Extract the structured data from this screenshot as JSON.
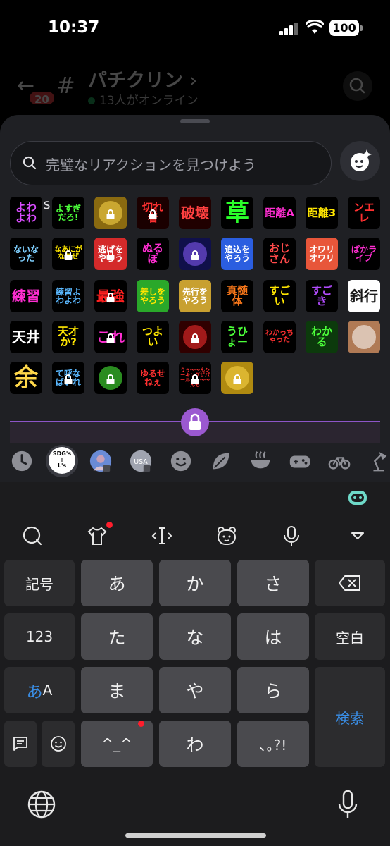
{
  "status_bar": {
    "time": "10:37",
    "battery": "100"
  },
  "channel_header": {
    "unread_count": "20",
    "title": "パチクリン",
    "title_chevron": "›",
    "online": "13人がオンライン"
  },
  "picker": {
    "search_placeholder": "完璧なリアクションを見つけよう",
    "pack_title": "SDG's＋L's",
    "emojis": [
      {
        "text": "よわよわ",
        "fg": "#d94cff",
        "bg": "#000000"
      },
      {
        "text": "よすぎだろ!",
        "fg": "#4cff3a",
        "bg": "#000000"
      },
      {
        "text": "",
        "fg": "#ffd84a",
        "bg": "#8a6a10"
      },
      {
        "text": "切れ者",
        "fg": "#ff3030",
        "bg": "#1a0000"
      },
      {
        "text": "破壊",
        "fg": "#ff4040",
        "bg": "#200000"
      },
      {
        "text": "草",
        "fg": "#2aff2a",
        "bg": "#000000"
      },
      {
        "text": "距離A",
        "fg": "#ff2ed2",
        "bg": "#000000"
      },
      {
        "text": "距離3",
        "fg": "#ffe600",
        "bg": "#000000"
      },
      {
        "text": "ンエレ",
        "fg": "#ff3030",
        "bg": "#000000"
      },
      {
        "text": "ないなった",
        "fg": "#7fd0ff",
        "bg": "#000000"
      },
      {
        "text": "なあにがなあぜ",
        "fg": "#ffe600",
        "bg": "#000000"
      },
      {
        "text": "逃げをやろう",
        "fg": "#ffffff",
        "bg": "#d42a2a"
      },
      {
        "text": "ぬるぽ",
        "fg": "#ff2ed2",
        "bg": "#000000"
      },
      {
        "text": "",
        "fg": "#8a5cff",
        "bg": "#10104a"
      },
      {
        "text": "追込をやろう",
        "fg": "#ffffff",
        "bg": "#2b5ee0"
      },
      {
        "text": "おじさん",
        "fg": "#ff4a4a",
        "bg": "#000000"
      },
      {
        "text": "オワリオワリ",
        "fg": "#ffffff",
        "bg": "#e8563a"
      },
      {
        "text": "ぱかライブ",
        "fg": "#ff2ed2",
        "bg": "#000000"
      },
      {
        "text": "練習",
        "fg": "#ff2ed2",
        "bg": "#000000"
      },
      {
        "text": "練習よわよわ",
        "fg": "#5ab8ff",
        "bg": "#000000"
      },
      {
        "text": "最強",
        "fg": "#ff2020",
        "bg": "#000000"
      },
      {
        "text": "差しをやろう",
        "fg": "#ffe600",
        "bg": "#2aa82a"
      },
      {
        "text": "先行をやろう",
        "fg": "#ffffff",
        "bg": "#c8a030"
      },
      {
        "text": "真髄体",
        "fg": "#ff7a1a",
        "bg": "#000000"
      },
      {
        "text": "すごい",
        "fg": "#ffe600",
        "bg": "#000000"
      },
      {
        "text": "すごき",
        "fg": "#b34cff",
        "bg": "#000000"
      },
      {
        "text": "斜行",
        "fg": "#1a1a1a",
        "bg": "#ffffff"
      },
      {
        "text": "天井",
        "fg": "#ffffff",
        "bg": "#000000"
      },
      {
        "text": "天才か?",
        "fg": "#ffe600",
        "bg": "#000000"
      },
      {
        "text": "これ",
        "fg": "#ff2ed2",
        "bg": "#000000"
      },
      {
        "text": "つよい",
        "fg": "#ffe600",
        "bg": "#000000"
      },
      {
        "text": "",
        "fg": "#ff3030",
        "bg": "#300000"
      },
      {
        "text": "うひょー",
        "fg": "#4cff3a",
        "bg": "#000000"
      },
      {
        "text": "わかっちゃった",
        "fg": "#ff3030",
        "bg": "#000000"
      },
      {
        "text": "わかる",
        "fg": "#4cff3a",
        "bg": "#0c3a0c"
      },
      {
        "text": "",
        "fg": "#ffffff",
        "bg": "#b07a55"
      },
      {
        "text": "余",
        "fg": "#ffd84a",
        "bg": "#000000"
      },
      {
        "text": "て呼なばいれ",
        "fg": "#5ab8ff",
        "bg": "#000000"
      },
      {
        "text": "",
        "fg": "#4cff3a",
        "bg": "#000000"
      },
      {
        "text": "ゆるせねぇ",
        "fg": "#ff3030",
        "bg": "#000000"
      },
      {
        "text": "うぅ〜〜んシーキングザパールよぉ〜〜んも",
        "fg": "#ff3030",
        "bg": "#000000"
      },
      {
        "text": "",
        "fg": "#ffd84a",
        "bg": "#b08a10"
      }
    ],
    "categories": [
      "recent-clock",
      "sdg-pack",
      "server-avatar-1",
      "server-avatar-usa",
      "smiley",
      "nature-leaf",
      "food-bowl",
      "gaming-controller",
      "activity-bike",
      "objects-lamp"
    ],
    "sdg_icon_text": "SDG's\n+\nL's"
  },
  "keyboard": {
    "row1": [
      "記号",
      "あ",
      "か",
      "さ"
    ],
    "row2": [
      "123",
      "た",
      "な",
      "は",
      "空白"
    ],
    "row3_label_a": "あ",
    "row3_label_b": "A",
    "row3": [
      "ま",
      "や",
      "ら"
    ],
    "search_key": "検索",
    "row4": [
      "^_^",
      "わ",
      "､｡?!"
    ]
  },
  "colors": {
    "sheet_bg": "#1f2024",
    "accent_purple": "#9b59d0",
    "key_blue": "#3a8ee6",
    "online_green": "#23a55a",
    "badge_red": "#ed4245"
  }
}
